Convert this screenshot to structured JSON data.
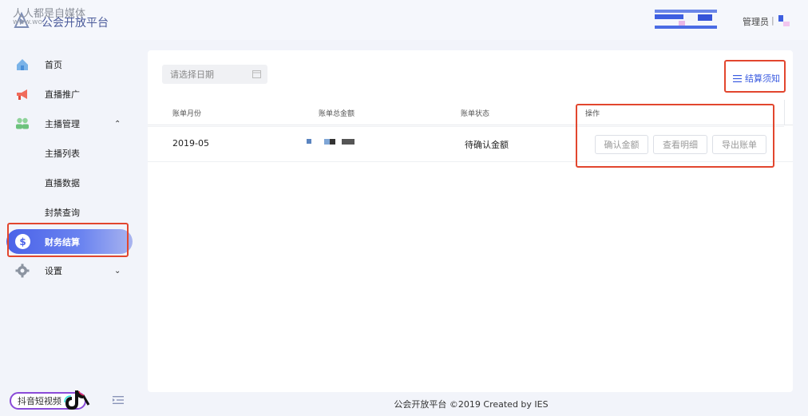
{
  "header": {
    "logo_watermark": "人人都是自媒体",
    "logo_watermark_sub": "www.wo...",
    "title": "公会开放平台",
    "admin_label": "管理员",
    "admin_separator": "|"
  },
  "sidebar": {
    "items": [
      {
        "label": "首页",
        "icon": "home-icon"
      },
      {
        "label": "直播推广",
        "icon": "megaphone-icon"
      },
      {
        "label": "主播管理",
        "icon": "people-icon",
        "expanded": true,
        "chevron": "⌃"
      },
      {
        "label": "主播列表"
      },
      {
        "label": "直播数据"
      },
      {
        "label": "封禁查询"
      },
      {
        "label": "财务结算",
        "icon": "dollar-icon",
        "active": true
      },
      {
        "label": "设置",
        "icon": "gear-icon",
        "chevron": "⌄"
      }
    ],
    "brand_badge": "抖音短视频",
    "colors": {
      "active_start": "#4a62e8",
      "active_end": "#a9b4ef",
      "highlight": "#e2462e"
    }
  },
  "main": {
    "date_picker_placeholder": "请选择日期",
    "notice_link": "结算须知",
    "table": {
      "headers": [
        "账单月份",
        "账单总金额",
        "账单状态",
        "操作"
      ],
      "rows": [
        {
          "month": "2019-05",
          "status": "待确认金额"
        }
      ],
      "actions": [
        "确认金额",
        "查看明细",
        "导出账单"
      ]
    }
  },
  "footer": {
    "text": "公会开放平台 ©2019 Created by IES"
  }
}
